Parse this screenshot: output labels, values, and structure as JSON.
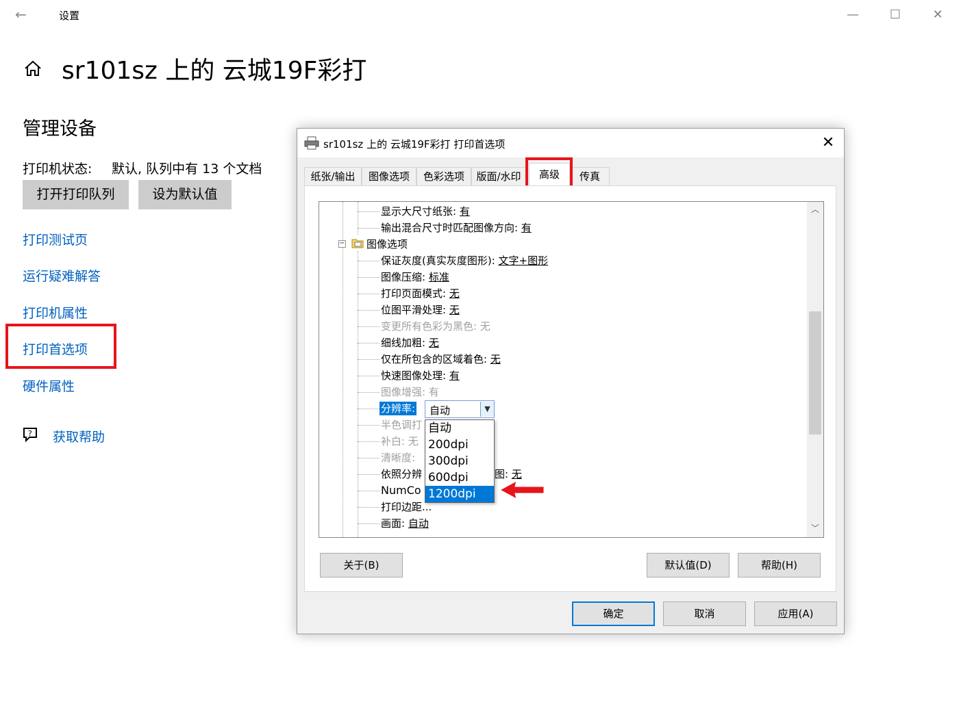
{
  "window": {
    "back_label": "←",
    "title": "设置",
    "minimize": "—",
    "maximize": "☐",
    "close": "✕"
  },
  "page": {
    "title": "sr101sz 上的 云城19F彩打",
    "section_title": "管理设备",
    "status_label": "打印机状态:",
    "status_value": "默认, 队列中有 13 个文档",
    "buttons": {
      "open_queue": "打开打印队列",
      "set_default": "设为默认值"
    },
    "links": {
      "test_page": "打印测试页",
      "troubleshoot": "运行疑难解答",
      "printer_properties": "打印机属性",
      "printing_preferences": "打印首选项",
      "hardware_properties": "硬件属性"
    },
    "help": "获取帮助"
  },
  "dialog": {
    "title": "sr101sz 上的 云城19F彩打 打印首选项",
    "close": "✕",
    "tabs": [
      "纸张/输出",
      "图像选项",
      "色彩选项",
      "版面/水印",
      "高级",
      "传真"
    ],
    "active_tab": "高级",
    "tree": {
      "show_large_paper": "显示大尺寸纸张: ",
      "show_large_paper_val": "有",
      "mixed_orientation": "输出混合尺寸时匹配图像方向: ",
      "mixed_orientation_val": "有",
      "image_options_folder": "图像选项",
      "gray_guarantee": "保证灰度(真实灰度图形): ",
      "gray_guarantee_val": "文字+图形",
      "compression": "图像压缩: ",
      "compression_val": "标准",
      "page_mode": "打印页面模式: ",
      "page_mode_val": "无",
      "bitmap_smooth": "位图平滑处理: ",
      "bitmap_smooth_val": "无",
      "all_black": "变更所有色彩为黑色: 无",
      "thin_line": "细线加粗: ",
      "thin_line_val": "无",
      "area_color": "仅在所包含的区域着色: ",
      "area_color_val": "无",
      "fast_image": "快速图像处理: ",
      "fast_image_val": "有",
      "image_enhance": "图像增强: 有",
      "resolution_label": "分辨率:",
      "halftone": "半色调打",
      "white_fill": "补白: 无",
      "sharpness": "清晰度: ",
      "by_resolution": "依照分辨",
      "by_resolution_tail": "图: ",
      "by_resolution_val": "无",
      "numcopies": "NumCo",
      "margins": "打印边距...",
      "screen": "画面: ",
      "screen_val": "自动"
    },
    "resolution_select": {
      "value": "自动",
      "options": [
        "自动",
        "200dpi",
        "300dpi",
        "600dpi",
        "1200dpi"
      ],
      "highlighted": "1200dpi"
    },
    "scroll_up": "︿",
    "scroll_down": "﹀",
    "buttons": {
      "about": "关于(B)",
      "defaults": "默认值(D)",
      "help": "帮助(H)",
      "ok": "确定",
      "cancel": "取消",
      "apply": "应用(A)"
    }
  },
  "colors": {
    "link": "#0060c0",
    "highlight_box": "#e8141c",
    "selection": "#0078d7"
  }
}
